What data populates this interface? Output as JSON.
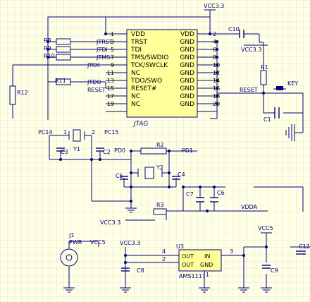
{
  "colors": {
    "background": "#ffffe6",
    "grid": "#d4d4c4",
    "wire": "#000080",
    "part": "#000080",
    "ic_fill": "#ffff99",
    "junction": "#000080"
  },
  "nets": {
    "vcc_top": "VCC3.3",
    "vcc_c10": "VCC3.3",
    "vcc_ldo_in": "VCC3.3",
    "vcc_c7": "VCC3.3",
    "vcc_out": "VCC5",
    "vcc_pwr": "VCC5",
    "vdda": "VDDA",
    "reset": "RESET",
    "jtrst": "JTRST",
    "jtdi": "JTDI",
    "jtms": "JTMS",
    "jtck": "JTCK",
    "jtdo": "JTDO",
    "reset_hash": "RESET",
    "pc14": "PC14",
    "pc15": "PC15",
    "pd0": "PD0",
    "pd1": "PD1"
  },
  "jtag": {
    "ref": "JTAG",
    "left_pins": [
      "VDD",
      "TRST",
      "TDI",
      "TMS/SWDIO",
      "TCK/SWCLK",
      "NC",
      "TDO/SWO",
      "RESET#",
      "NC",
      "NC"
    ],
    "left_nums": [
      "1",
      "3",
      "5",
      "7",
      "9",
      "11",
      "13",
      "15",
      "17",
      "19"
    ],
    "right_pins": [
      "VDD",
      "GND",
      "GND",
      "GND",
      "GND",
      "GND",
      "GND",
      "GND",
      "GND",
      "GND"
    ],
    "right_nums": [
      "2",
      "4",
      "6",
      "8",
      "10",
      "12",
      "14",
      "16",
      "18",
      "20"
    ]
  },
  "parts": {
    "r8": "R8",
    "r9": "R9",
    "r10": "R10",
    "r11": "R11",
    "r12": "R12",
    "r1": "R1",
    "r2": "R2",
    "r3": "R3",
    "c10": "C10",
    "c1": "C1",
    "c2": "C2",
    "c3": "C3",
    "c4": "C4",
    "c5": "C5",
    "c6": "C6",
    "c7": "C7",
    "c8": "C8",
    "c9": "C9",
    "c12": "C12",
    "y1": "Y1",
    "y2": "Y2",
    "key": "KEY",
    "j1": "J1",
    "pwr": "PWR",
    "u3": "U3",
    "ams": "AMS1117"
  },
  "ldo": {
    "out1": "OUT",
    "in": "IN",
    "out2": "OUT",
    "gnd": "GND",
    "pin4": "4",
    "pin2": "2",
    "pin3": "3",
    "pin1": "1"
  },
  "xtal_pins": {
    "pin1": "1",
    "pin2": "2"
  }
}
